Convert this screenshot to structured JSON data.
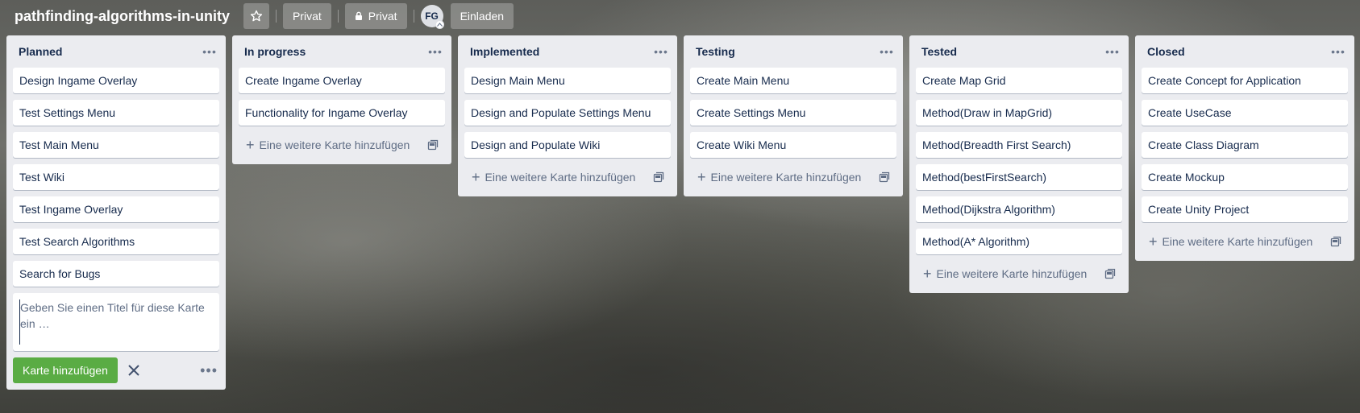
{
  "board": {
    "title": "pathfinding-algorithms-in-unity",
    "visibility_label": "Privat",
    "privacy_label": "Privat",
    "member_initials": "FG",
    "invite_label": "Einladen",
    "icons": [
      "star-icon",
      "lock-icon",
      "close-icon"
    ]
  },
  "add_card_label": "Eine weitere Karte hinzufügen",
  "composer": {
    "placeholder": "Geben Sie einen Titel für diese Karte ein …",
    "submit_label": "Karte hinzufügen"
  },
  "lists": [
    {
      "title": "Planned",
      "cards": [
        "Design Ingame Overlay",
        "Test Settings Menu",
        "Test Main Menu",
        "Test Wiki",
        "Test Ingame Overlay",
        "Test Search Algorithms",
        "Search for Bugs"
      ]
    },
    {
      "title": "In progress",
      "cards": [
        "Create Ingame Overlay",
        "Functionality for Ingame Overlay"
      ]
    },
    {
      "title": "Implemented",
      "cards": [
        "Design Main Menu",
        "Design and Populate Settings Menu",
        "Design and Populate Wiki"
      ]
    },
    {
      "title": "Testing",
      "cards": [
        "Create Main Menu",
        "Create Settings Menu",
        "Create Wiki Menu"
      ]
    },
    {
      "title": "Tested",
      "cards": [
        "Create Map Grid",
        "Method(Draw in MapGrid)",
        "Method(Breadth First Search)",
        "Method(bestFirstSearch)",
        "Method(Dijkstra Algorithm)",
        "Method(A* Algorithm)"
      ]
    },
    {
      "title": "Closed",
      "cards": [
        "Create Concept for Application",
        "Create UseCase",
        "Create Class Diagram",
        "Create Mockup",
        "Create Unity Project"
      ]
    }
  ]
}
